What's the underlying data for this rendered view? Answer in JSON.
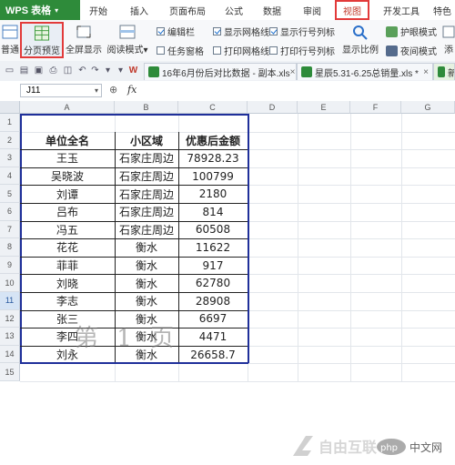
{
  "app": {
    "name": "WPS 表格"
  },
  "menu": [
    "开始",
    "插入",
    "页面布局",
    "公式",
    "数据",
    "审阅",
    "视图",
    "开发工具",
    "特色"
  ],
  "menu_active": "视图",
  "ribbon": {
    "normal": "普通",
    "page_break_preview": "分页预览",
    "full_screen": "全屏显示",
    "reading_mode": "阅读模式",
    "reading_mode_caret": "▾",
    "checkboxes": {
      "edit_bar": "编辑栏",
      "task_pane": "任务窗格",
      "show_gridlines": "显示网格线",
      "print_gridlines": "打印网格线",
      "show_headers": "显示行号列标",
      "print_headers": "打印行号列标"
    },
    "zoom": "显示比例",
    "eye_mode": "护眼模式",
    "night_mode": "夜间模式",
    "add": "添"
  },
  "files": [
    {
      "name": "16年6月份后对比数据 - 副本.xls",
      "close": "×"
    },
    {
      "name": "星辰5.31-6.25总销量.xls *",
      "close": "×"
    },
    {
      "name": "新"
    }
  ],
  "formula_bar": {
    "name_box": "J11",
    "fx": "fx",
    "value": ""
  },
  "columns": [
    "A",
    "B",
    "C",
    "D",
    "E",
    "F",
    "G"
  ],
  "rows": [
    "1",
    "2",
    "3",
    "4",
    "5",
    "6",
    "7",
    "8",
    "9",
    "10",
    "11",
    "12",
    "13",
    "14",
    "15"
  ],
  "selected_row": "11",
  "table": {
    "headers": [
      "单位全名",
      "小区域",
      "优惠后金额"
    ],
    "rows": [
      [
        "王玉",
        "石家庄周边",
        "78928.23"
      ],
      [
        "吴晓波",
        "石家庄周边",
        "100799"
      ],
      [
        "刘谭",
        "石家庄周边",
        "2180"
      ],
      [
        "吕布",
        "石家庄周边",
        "814"
      ],
      [
        "冯五",
        "石家庄周边",
        "60508"
      ],
      [
        "花花",
        "衡水",
        "11622"
      ],
      [
        "菲菲",
        "衡水",
        "917"
      ],
      [
        "刘晓",
        "衡水",
        "62780"
      ],
      [
        "李志",
        "衡水",
        "28908"
      ],
      [
        "张三",
        "衡水",
        "6697"
      ],
      [
        "李四",
        "衡水",
        "4471"
      ],
      [
        "刘永",
        "衡水",
        "26658.7"
      ]
    ]
  },
  "watermark": "第 1 页",
  "logo": {
    "text1": "自由互联",
    "text2": "php",
    "text3": "中文网"
  },
  "colors": {
    "accent_green": "#2e8b3a",
    "highlight_red": "#e23a3a",
    "table_border": "#222222"
  }
}
